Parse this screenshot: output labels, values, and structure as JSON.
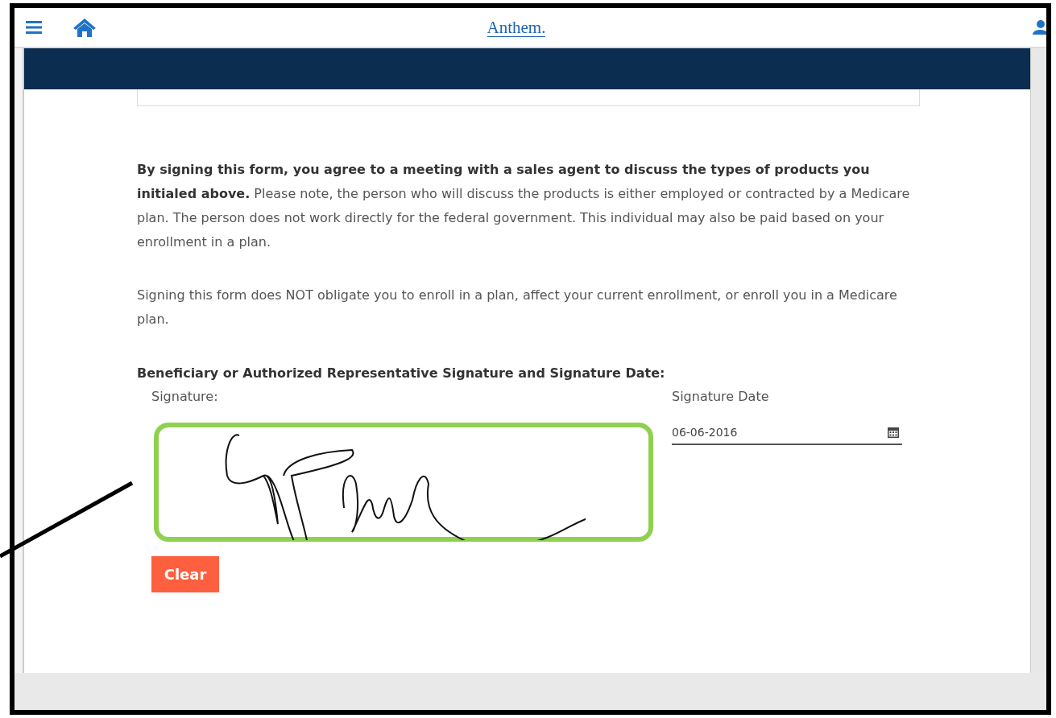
{
  "header": {
    "logo": "Anthem."
  },
  "paragraphs": [
    "**By signing this form, you agree to a meeting with a sales agent to discuss the types of products you initialed above.** Please note, the person who will discuss the products is either employed or contracted by a Medicare plan. The person does not work directly for the federal government. This individual may also be paid based on your enrollment in a plan.",
    "Signing this form does NOT obligate you to enroll in a plan, affect your current enrollment, or enroll you in a Medicare plan."
  ],
  "signature_section": {
    "heading": "Beneficiary or Authorized Representative Signature and Signature Date:",
    "signature_label": "Signature:",
    "signed": true,
    "highlighted": true,
    "clear_button": "Clear",
    "date_label": "Signature Date",
    "date_value": "06-06-2016"
  }
}
